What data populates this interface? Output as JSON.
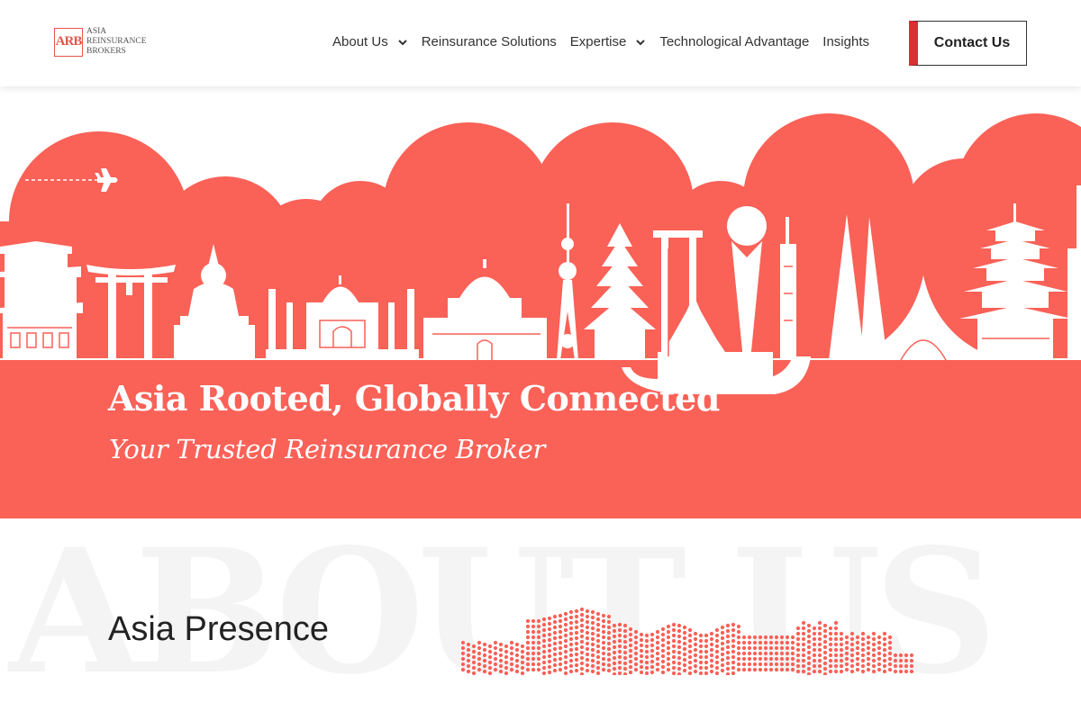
{
  "brand": {
    "logo_mark": "ARB",
    "logo_lines": [
      "Asia",
      "Reinsurance",
      "Brokers"
    ],
    "accent": "#fa6157",
    "contact_accent": "#d92f35"
  },
  "nav": {
    "items": [
      {
        "label": "About Us",
        "dropdown": true
      },
      {
        "label": "Reinsurance Solutions",
        "dropdown": false
      },
      {
        "label": "Expertise",
        "dropdown": true
      },
      {
        "label": "Technological Advantage",
        "dropdown": false
      },
      {
        "label": "Insights",
        "dropdown": false
      }
    ],
    "contact_label": "Contact Us"
  },
  "hero": {
    "title": "Asia Rooted, Globally Connected",
    "subtitle": "Your Trusted Reinsurance Broker",
    "icons": [
      "airplane-icon",
      "chevron-down-icon"
    ]
  },
  "about": {
    "background_word": "ABOUT US",
    "section_title": "Asia Presence"
  }
}
